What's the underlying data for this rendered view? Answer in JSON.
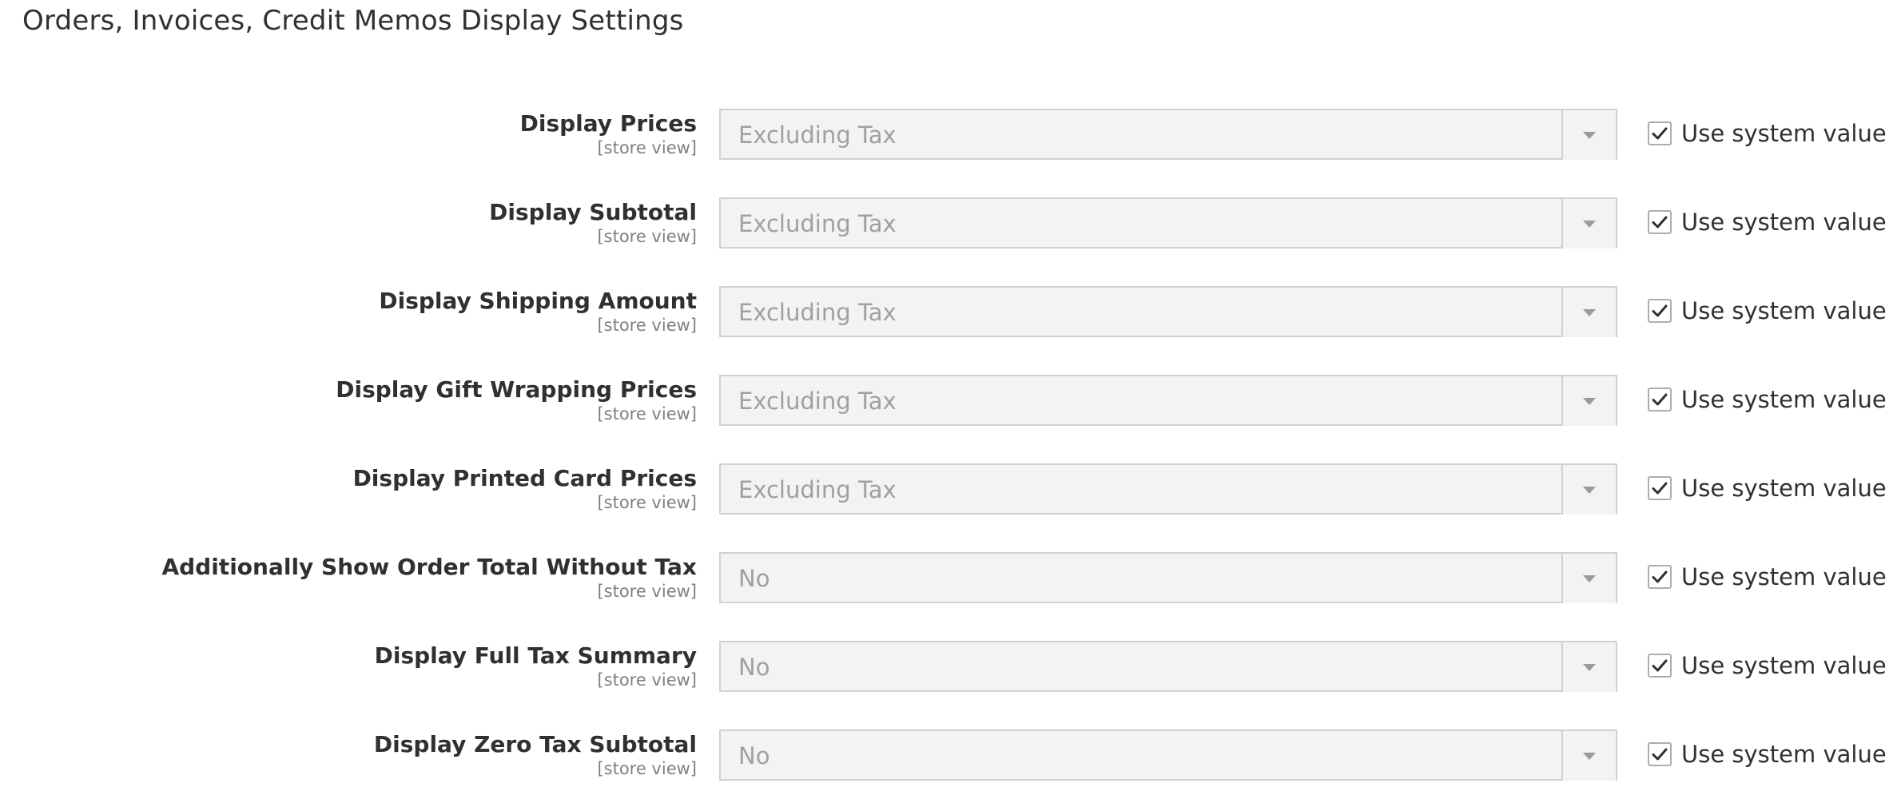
{
  "section": {
    "title": "Orders, Invoices, Credit Memos Display Settings"
  },
  "icons": {
    "dropdown": "chevron-down-icon",
    "check": "checkmark-icon"
  },
  "rows": [
    {
      "label": "Display Prices",
      "scope": "[store view]",
      "value": "Excluding Tax",
      "use_system_label": "Use system value",
      "use_system_checked": true
    },
    {
      "label": "Display Subtotal",
      "scope": "[store view]",
      "value": "Excluding Tax",
      "use_system_label": "Use system value",
      "use_system_checked": true
    },
    {
      "label": "Display Shipping Amount",
      "scope": "[store view]",
      "value": "Excluding Tax",
      "use_system_label": "Use system value",
      "use_system_checked": true
    },
    {
      "label": "Display Gift Wrapping Prices",
      "scope": "[store view]",
      "value": "Excluding Tax",
      "use_system_label": "Use system value",
      "use_system_checked": true
    },
    {
      "label": "Display Printed Card Prices",
      "scope": "[store view]",
      "value": "Excluding Tax",
      "use_system_label": "Use system value",
      "use_system_checked": true
    },
    {
      "label": "Additionally Show Order Total Without Tax",
      "scope": "[store view]",
      "value": "No",
      "use_system_label": "Use system value",
      "use_system_checked": true
    },
    {
      "label": "Display Full Tax Summary",
      "scope": "[store view]",
      "value": "No",
      "use_system_label": "Use system value",
      "use_system_checked": true
    },
    {
      "label": "Display Zero Tax Subtotal",
      "scope": "[store view]",
      "value": "No",
      "use_system_label": "Use system value",
      "use_system_checked": true
    }
  ]
}
